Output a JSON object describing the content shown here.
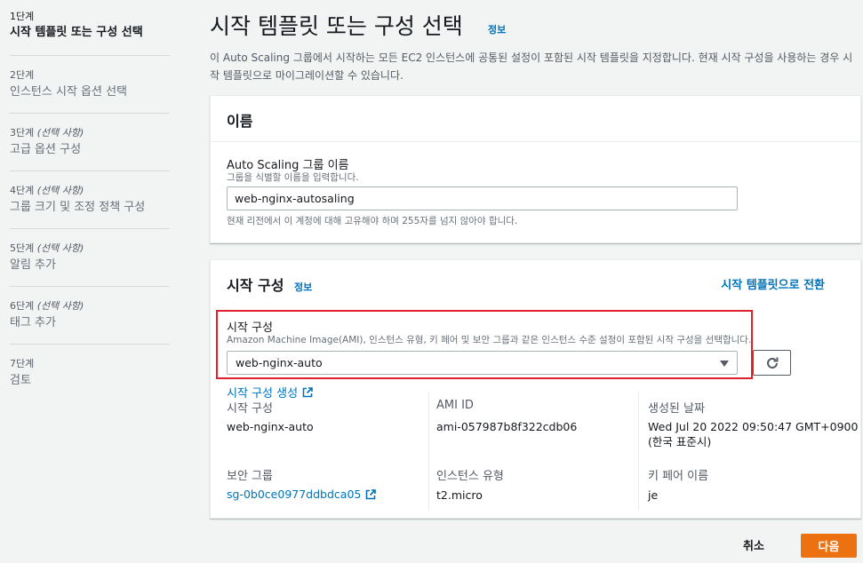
{
  "sidebar": {
    "steps": [
      {
        "num": "1단계",
        "optional": "",
        "label": "시작 템플릿 또는 구성 선택"
      },
      {
        "num": "2단계",
        "optional": "",
        "label": "인스턴스 시작 옵션 선택"
      },
      {
        "num": "3단계",
        "optional": "(선택 사항)",
        "label": "고급 옵션 구성"
      },
      {
        "num": "4단계",
        "optional": "(선택 사항)",
        "label": "그룹 크기 및 조정 정책 구성"
      },
      {
        "num": "5단계",
        "optional": "(선택 사항)",
        "label": "알림 추가"
      },
      {
        "num": "6단계",
        "optional": "(선택 사항)",
        "label": "태그 추가"
      },
      {
        "num": "7단계",
        "optional": "",
        "label": "검토"
      }
    ]
  },
  "header": {
    "title": "시작 템플릿 또는 구성 선택",
    "info": "정보",
    "description": "이 Auto Scaling 그룹에서 시작하는 모든 EC2 인스턴스에 공통된 설정이 포함된 시작 템플릿을 지정합니다. 현재 시작 구성을 사용하는 경우 시작 템플릿으로 마이그레이션할 수 있습니다."
  },
  "name_panel": {
    "title": "이름",
    "field_label": "Auto Scaling 그룹 이름",
    "field_desc": "그룹을 식별할 이름을 입력합니다.",
    "value": "web-nginx-autosaling",
    "hint": "현재 리전에서 이 계정에 대해 고유해야 하며 255자를 넘지 않아야 합니다."
  },
  "launch_panel": {
    "title": "시작 구성",
    "info": "정보",
    "switch_link": "시작 템플릿으로 전환",
    "field_label": "시작 구성",
    "field_desc": "Amazon Machine Image(AMI), 인스턴스 유형, 키 페어 및 보안 그룹과 같은 인스턴스 수준 설정이 포함된 시작 구성을 선택합니다.",
    "selected": "web-nginx-auto",
    "create_link": "시작 구성 생성",
    "details": {
      "config_key": "시작 구성",
      "config_val": "web-nginx-auto",
      "ami_key": "AMI ID",
      "ami_val": "ami-057987b8f322cdb06",
      "created_key": "생성된 날짜",
      "created_val_1": "Wed Jul 20 2022 09:50:47 GMT+0900",
      "created_val_2": "(한국 표준시)",
      "sg_key": "보안 그룹",
      "sg_val": "sg-0b0ce0977ddbdca05",
      "type_key": "인스턴스 유형",
      "type_val": "t2.micro",
      "keypair_key": "키 페어 이름",
      "keypair_val": "je"
    }
  },
  "footer": {
    "cancel": "취소",
    "next": "다음"
  },
  "colors": {
    "accent": "#ec7211",
    "link": "#0073bb",
    "highlight": "#e0202b"
  }
}
